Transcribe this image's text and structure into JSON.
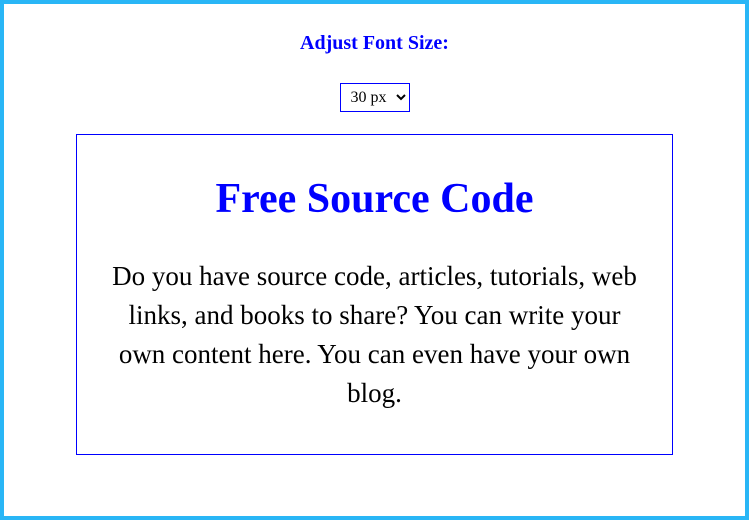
{
  "header": {
    "label": "Adjust Font Size:"
  },
  "fontSelect": {
    "selected": "30 px"
  },
  "content": {
    "title": "Free Source Code",
    "paragraph": "Do you have source code, articles, tutorials, web links, and books to share? You can write your own content here. You can even have your own blog."
  }
}
